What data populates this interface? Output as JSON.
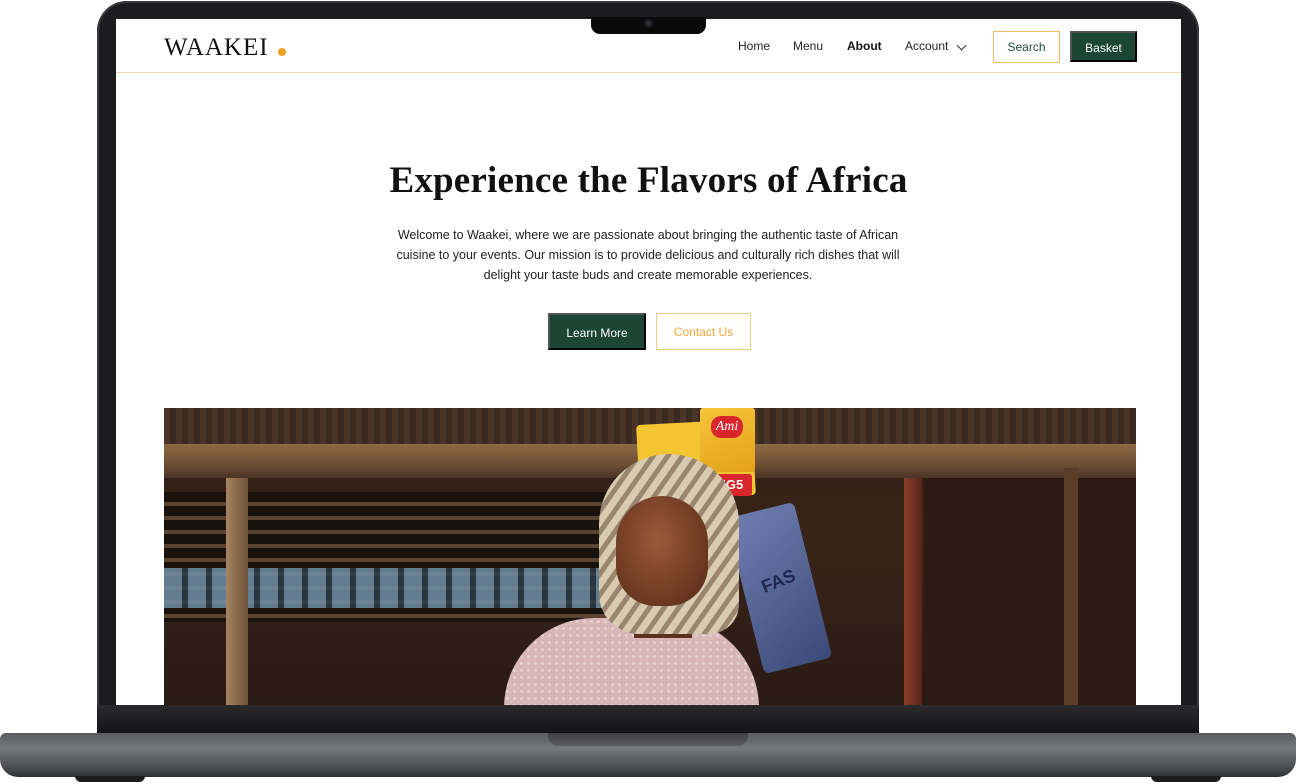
{
  "site": {
    "logo_text": "WAAKEI",
    "accent_color": "#f0a020",
    "primary_color": "#1b4535"
  },
  "nav": {
    "items": [
      {
        "label": "Home",
        "active": false
      },
      {
        "label": "Menu",
        "active": false
      },
      {
        "label": "About",
        "active": true
      },
      {
        "label": "Account",
        "active": false,
        "has_dropdown": true
      }
    ],
    "search_label": "Search",
    "basket_label": "Basket"
  },
  "hero": {
    "title": "Experience the Flavors of Africa",
    "text": "Welcome to Waakei, where we are passionate about bringing the authentic taste of African cuisine to your events. Our mission is to provide delicious and culturally rich dishes that will delight your taste buds and create memorable experiences.",
    "primary_button": "Learn More",
    "secondary_button": "Contact Us"
  },
  "photo": {
    "sign_brand": "Ami",
    "sign_badge": "BIG5",
    "bag_text": "FAS"
  }
}
